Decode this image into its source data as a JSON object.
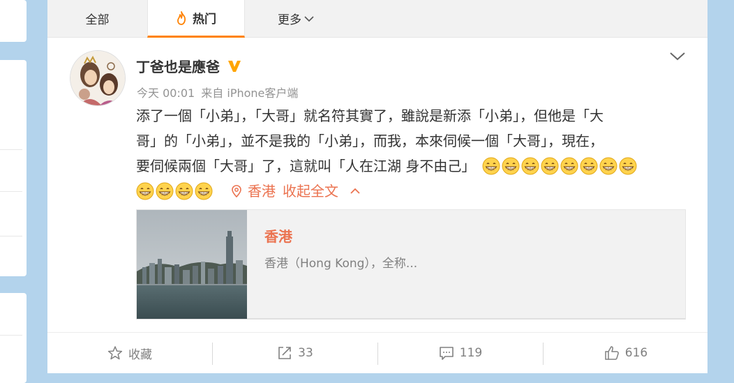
{
  "tabs": {
    "all": "全部",
    "hot": "热门",
    "more": "更多"
  },
  "post": {
    "author": "丁爸也是應爸",
    "time": "今天 00:01",
    "source": "来自 iPhone客户端",
    "text_lines": [
      "添了一個「小弟」，「大哥」就名符其實了，雖說是新添「小弟」，但他是「大",
      "哥」的「小弟」，並不是我的「小弟」，而我，本來伺候一個「大哥」，現在，",
      "要伺候兩個「大哥」了，這就叫「人在江湖 身不由己」"
    ],
    "emoji_line3_count": 8,
    "emoji_line4_count": 4,
    "location_tag": "香港",
    "collapse_text": "收起全文"
  },
  "location_card": {
    "title": "香港",
    "description": "香港（Hong Kong），全称..."
  },
  "actions": {
    "favorite": "收藏",
    "repost": "33",
    "comment": "119",
    "like": "616"
  },
  "colors": {
    "accent": "#eb7350",
    "tab_active": "#ff8200",
    "verified": "#ffa500",
    "background": "#b3d3ec"
  },
  "icons": [
    "flame-icon",
    "chevron-down-icon",
    "verified-badge-icon",
    "location-pin-icon",
    "chevron-up-icon",
    "star-icon",
    "share-icon",
    "comment-icon",
    "thumbs-up-icon",
    "grin-emoji-icon"
  ]
}
